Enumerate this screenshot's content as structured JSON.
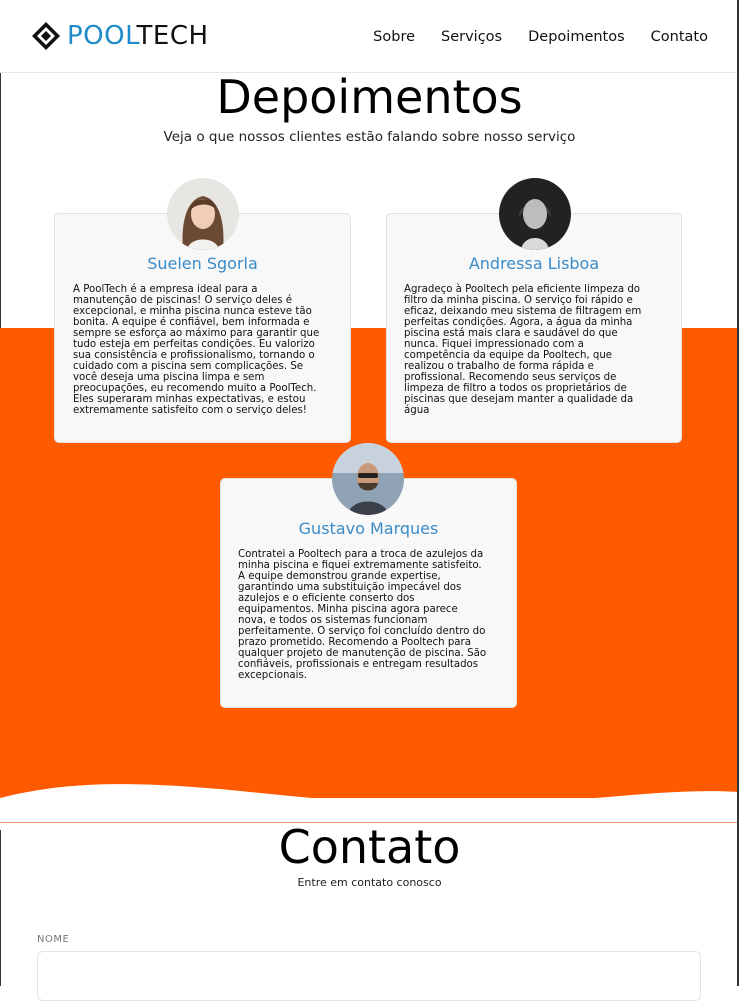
{
  "brand": {
    "logo_part1": "POOL",
    "logo_part2": "TECH",
    "accent_color": "#1f8ac9",
    "orange": "#ff5a00"
  },
  "nav": {
    "items": [
      "Sobre",
      "Serviços",
      "Depoimentos",
      "Contato"
    ]
  },
  "testimonials": {
    "title": "Depoimentos",
    "subtitle": "Veja o que nossos clientes estão falando sobre nosso serviço",
    "cards": [
      {
        "name": "Suelen Sgorla",
        "text": [
          "A PoolTech é a empresa ideal para a",
          "manutenção de piscinas! O serviço deles é",
          "excepcional, e minha piscina nunca esteve tão",
          "bonita. A equipe é confiável, bem informada e",
          "sempre se esforça ao máximo para garantir que",
          "tudo esteja em perfeitas condições. Eu valorizo",
          "sua consistência e profissionalismo, tornando o",
          "cuidado com a piscina sem complicações. Se",
          "você deseja uma piscina limpa e sem",
          "preocupações, eu recomendo muito a PoolTech.",
          "Eles superaram minhas expectativas, e estou",
          "extremamente satisfeito com o serviço deles!"
        ]
      },
      {
        "name": "Andressa Lisboa",
        "text": [
          "Agradeço à Pooltech pela eficiente limpeza do",
          "filtro da minha piscina. O serviço foi rápido e",
          "eficaz, deixando meu sistema de filtragem em",
          "perfeitas condições. Agora, a água da minha",
          "piscina está mais clara e saudável do que",
          "nunca. Fiquei impressionado com a",
          "competência da equipe da Pooltech, que",
          "realizou o trabalho de forma rápida e",
          "profissional. Recomendo seus serviços de",
          "limpeza de filtro a todos os proprietários de",
          "piscinas que desejam manter a qualidade da",
          "água"
        ]
      },
      {
        "name": "Gustavo Marques",
        "text": [
          "Contratei a Pooltech para a troca de azulejos da",
          "minha piscina e fiquei extremamente satisfeito.",
          "A equipe demonstrou grande expertise,",
          "garantindo uma substituição impecável dos",
          "azulejos e o eficiente conserto dos",
          "equipamentos. Minha piscina agora parece",
          "nova, e todos os sistemas funcionam",
          "perfeitamente. O serviço foi concluído dentro do",
          "prazo prometido. Recomendo a Pooltech para",
          "qualquer projeto de manutenção de piscina. São",
          "confiáveis, profissionais e entregam resultados",
          "excepcionais."
        ]
      }
    ]
  },
  "contact": {
    "title": "Contato",
    "subtitle": "Entre em contato conosco",
    "name_label": "NOME"
  }
}
